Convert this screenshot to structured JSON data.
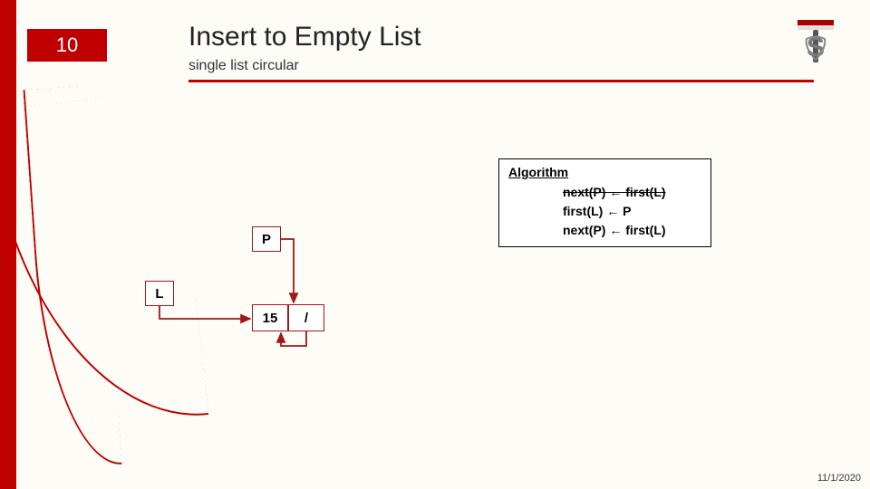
{
  "page_number": "10",
  "title": "Insert to Empty List",
  "subtitle": "single list circular",
  "algorithm": {
    "heading": "Algorithm",
    "line1": "next(P) ← first(L)",
    "line2": "first(L) ← P",
    "line3": "next(P) ← first(L)"
  },
  "diagram": {
    "L": "L",
    "P": "P",
    "value": "15",
    "slash": "/"
  },
  "date": "11/1/2020"
}
